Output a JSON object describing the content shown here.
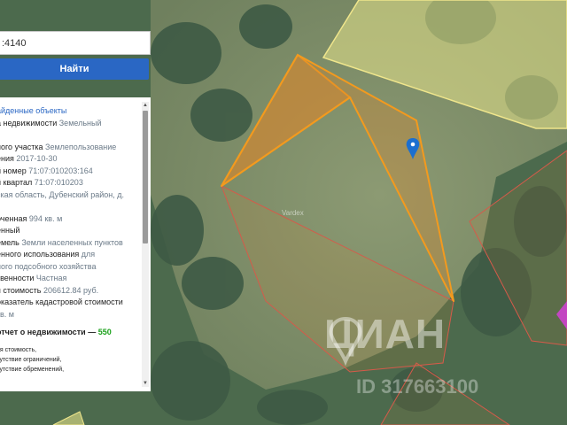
{
  "search": {
    "value": ":4140"
  },
  "find_button": {
    "label": "Найти"
  },
  "info_panel": {
    "title": "айденные объекты",
    "rows": [
      {
        "label": "а недвижимости",
        "value": "Земельный"
      },
      {
        "label": "",
        "value": ""
      },
      {
        "label": "ного участка",
        "value": "Землепользование"
      },
      {
        "label": "ения",
        "value": "2017-10-30"
      },
      {
        "label": "й номер",
        "value": "71:07:010203:164"
      },
      {
        "label": "й квартал",
        "value": "71:07:010203"
      },
      {
        "label": "",
        "value": "ская область, Дубенский район, д."
      },
      {
        "label": "",
        "value": ""
      },
      {
        "label": "оченная",
        "value": "994 кв. м"
      },
      {
        "label": "енный",
        "value": ""
      },
      {
        "label": "емель",
        "value": "Земли населенных пунктов"
      },
      {
        "label": "енного использования",
        "value": "для"
      },
      {
        "label": "",
        "value": "ного подсобного хозяйства"
      },
      {
        "label": "твенности",
        "value": "Частная"
      },
      {
        "label": "я стоимость",
        "value": "206612.84 руб."
      },
      {
        "label": "оказатель кадастровой стоимости",
        "value": ""
      },
      {
        "label": "",
        "value": "кв. м"
      }
    ],
    "report_prefix": "отчет о недвижимости —",
    "report_count": "550",
    "small_lines": [
      "ая стоимость,",
      "сутствие ограничений,",
      "сутствие обременений,"
    ]
  },
  "map": {
    "faint_label": "Vardex",
    "watermark": "ЦИАН",
    "watermark_id": "ID 317663100",
    "colors": {
      "parcel_outline": "#f39a1e",
      "parcel_fill": "#d8872f",
      "neighbor_fill": "#e6e38a",
      "neighbor_outline": "#f0e68c",
      "red_outline": "#d65a4a",
      "marker": "#1b6fd0",
      "magenta": "#d43fd6"
    },
    "icons": [
      "location-pin-icon",
      "cian-logo-icon"
    ]
  }
}
